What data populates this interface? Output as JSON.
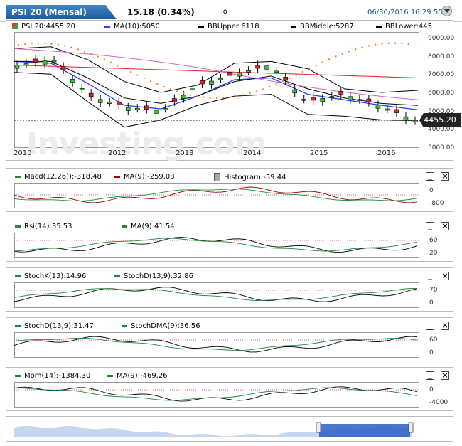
{
  "header": {
    "tab_label": "PSI 20 (Mensal)",
    "price_change": "15.18 (0.34%)",
    "symbol_fragment": "io",
    "datetime": "06/30/2016 16:29:55"
  },
  "main_legend": [
    {
      "name": "PSI 20:4455.20",
      "color": "#1a8a3a"
    },
    {
      "name": "MA(10):5050",
      "color": "#1f3cff"
    },
    {
      "name": "BBUpper:6118",
      "color": "#000000"
    },
    {
      "name": "BBMiddle:5287",
      "color": "#000000"
    },
    {
      "name": "BBLower:445",
      "color": "#000000"
    }
  ],
  "price_tag": "4455.20",
  "watermark": "Investing.com",
  "y_ticks": [
    "9000.00",
    "8000.00",
    "7000.00",
    "6000.00",
    "5000.00",
    "4000.00",
    "3000.00"
  ],
  "x_ticks": [
    "2010",
    "2012",
    "2013",
    "2014",
    "2015",
    "2016"
  ],
  "sub_panels": [
    {
      "legend": [
        {
          "name": "Macd(12,26)):-318.48",
          "color": "#1a8a3a"
        },
        {
          "name": "MA(9):-259.03",
          "color": "#a00000"
        },
        {
          "name": "Histogram:-59.44",
          "color": "#999999"
        }
      ],
      "ticks": [
        "0",
        "-800"
      ]
    },
    {
      "legend": [
        {
          "name": "Rsi(14):35.53",
          "color": "#1a8a3a"
        },
        {
          "name": "MA(9):41.54",
          "color": "#1a8a3a"
        }
      ],
      "ticks": [
        "60",
        "20"
      ]
    },
    {
      "legend": [
        {
          "name": "StochK(13):14.96",
          "color": "#1a8a3a"
        },
        {
          "name": "StochD(13,9):32.86",
          "color": "#1a8a3a"
        }
      ],
      "ticks": [
        "70",
        "0"
      ]
    },
    {
      "legend": [
        {
          "name": "StochD(13,9):31.47",
          "color": "#1a8a3a"
        },
        {
          "name": "StochDMA(9):36.56",
          "color": "#1a8a3a"
        }
      ],
      "ticks": [
        "60",
        "0"
      ]
    },
    {
      "legend": [
        {
          "name": "Mom(14):-1384.30",
          "color": "#1a8a3a"
        },
        {
          "name": "MA(9):-469.26",
          "color": "#1a8a3a"
        }
      ],
      "ticks": [
        "0",
        "-4000"
      ]
    }
  ],
  "chart_data": {
    "type": "line",
    "title": "PSI 20 (Mensal)",
    "x": [
      "2010",
      "2012",
      "2013",
      "2014",
      "2015",
      "2016"
    ],
    "ylim": [
      3000,
      9000
    ],
    "series": [
      {
        "name": "PSI 20",
        "values": [
          7500,
          7800,
          5800,
          5200,
          5000,
          6400,
          7000,
          7500,
          5500,
          5900,
          5300,
          4455
        ]
      },
      {
        "name": "MA(10)",
        "values": [
          7700,
          7600,
          6500,
          5300,
          5100,
          5800,
          6700,
          6800,
          5900,
          5600,
          5300,
          5050
        ]
      },
      {
        "name": "BBUpper",
        "values": [
          8400,
          8500,
          7800,
          6600,
          6000,
          6400,
          7600,
          7700,
          7300,
          6200,
          6000,
          6118
        ]
      },
      {
        "name": "BBMiddle",
        "values": [
          7700,
          7700,
          6800,
          5700,
          5400,
          5800,
          6600,
          6900,
          6200,
          5700,
          5400,
          5287
        ]
      },
      {
        "name": "BBLower",
        "values": [
          7100,
          7000,
          5500,
          4100,
          4500,
          5300,
          5800,
          5900,
          4800,
          4700,
          4500,
          4450
        ]
      }
    ]
  }
}
